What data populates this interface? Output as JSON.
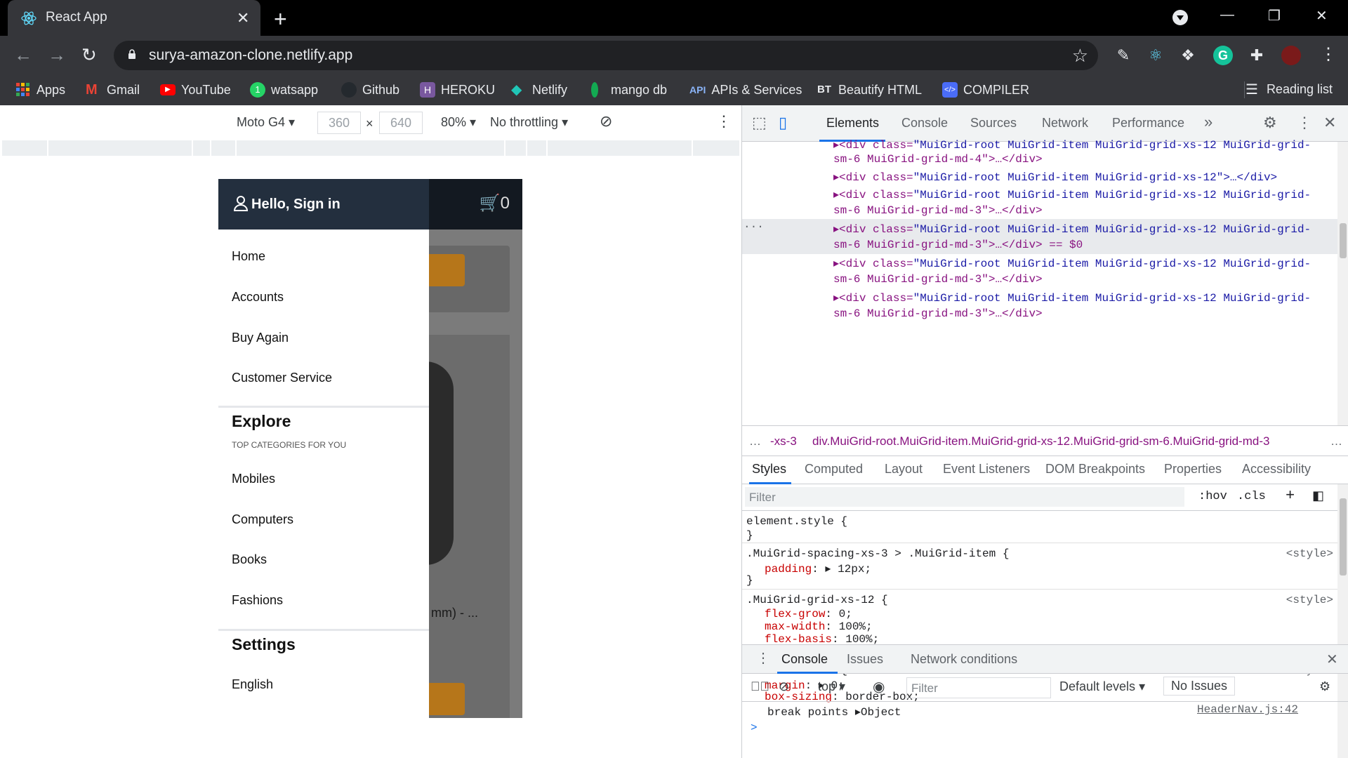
{
  "browser": {
    "tab_title": "React App",
    "url": "surya-amazon-clone.netlify.app",
    "bookmarks": [
      "Apps",
      "Gmail",
      "YouTube",
      "watsapp",
      "Github",
      "HEROKU",
      "Netlify",
      "mango db",
      "APIs & Services",
      "Beautify HTML",
      "COMPILER"
    ],
    "api_badge": "API",
    "reading_list": "Reading list"
  },
  "device_toolbar": {
    "device": "Moto G4",
    "width": "360",
    "times": "×",
    "height": "640",
    "zoom": "80%",
    "throttle": "No throttling"
  },
  "app": {
    "greeting": "Hello, Sign in",
    "cart_count": "0",
    "menu_top": [
      "Home",
      "Accounts",
      "Buy Again",
      "Customer Service"
    ],
    "explore_title": "Explore",
    "explore_sub": "TOP CATEGORIES FOR YOU",
    "menu_categories": [
      "Mobiles",
      "Computers",
      "Books",
      "Fashions"
    ],
    "settings_title": "Settings",
    "menu_settings": [
      "English"
    ],
    "product_text": "mm) - ..."
  },
  "devtools": {
    "tabs": [
      "Elements",
      "Console",
      "Sources",
      "Network",
      "Performance"
    ],
    "more": "»",
    "elements": [
      {
        "cls": "\"MuiGrid-root MuiGrid-item MuiGrid-grid-xs-12 MuiGrid-grid-",
        "rest": "sm-6 MuiGrid-grid-md-4\">…</div>"
      },
      {
        "cls": "\"MuiGrid-root MuiGrid-item MuiGrid-grid-xs-12\">…</div>",
        "rest": ""
      },
      {
        "cls": "\"MuiGrid-root MuiGrid-item MuiGrid-grid-xs-12 MuiGrid-grid-",
        "rest": "sm-6 MuiGrid-grid-md-3\">…</div>"
      },
      {
        "cls": "\"MuiGrid-root MuiGrid-item MuiGrid-grid-xs-12 MuiGrid-grid-",
        "rest": "sm-6 MuiGrid-grid-md-3\">…</div> == $0"
      },
      {
        "cls": "\"MuiGrid-root MuiGrid-item MuiGrid-grid-xs-12 MuiGrid-grid-",
        "rest": "sm-6 MuiGrid-grid-md-3\">…</div>"
      },
      {
        "cls": "\"MuiGrid-root MuiGrid-item MuiGrid-grid-xs-12 MuiGrid-grid-",
        "rest": "sm-6 MuiGrid-grid-md-3\">…</div>"
      }
    ],
    "el_prefix": "<div class=",
    "crumb_left": "-xs-3",
    "crumb_main": "div.MuiGrid-root.MuiGrid-item.MuiGrid-grid-xs-12.MuiGrid-grid-sm-6.MuiGrid-grid-md-3",
    "style_tabs": [
      "Styles",
      "Computed",
      "Layout",
      "Event Listeners",
      "DOM Breakpoints",
      "Properties",
      "Accessibility"
    ],
    "filter_placeholder": "Filter",
    "hov": ":hov",
    "cls": ".cls",
    "rules": {
      "r1_sel": "element.style {",
      "close": "}",
      "r2_sel": ".MuiGrid-spacing-xs-3 > .MuiGrid-item {",
      "r2_p1k": "padding",
      "r2_p1v": "12px;",
      "src": "<style>",
      "r3_sel": ".MuiGrid-grid-xs-12 {",
      "r3_p1k": "flex-grow",
      "r3_p1v": "0;",
      "r3_p2k": "max-width",
      "r3_p2v": "100%;",
      "r3_p3k": "flex-basis",
      "r3_p3v": "100%;",
      "r4_sel": ".MuiGrid-item {",
      "r4_p1k": "margin",
      "r4_p1v": "0;",
      "r4_p2k": "box-sizing",
      "r4_p2v": "border-box;"
    },
    "drawer_tabs": [
      "Console",
      "Issues",
      "Network conditions"
    ],
    "context": "top",
    "console_filter": "Filter",
    "levels": "Default levels",
    "issues": "No Issues",
    "log_text": "break points",
    "log_obj": "Object",
    "log_src": "HeaderNav.js:42",
    "prompt": ">"
  }
}
